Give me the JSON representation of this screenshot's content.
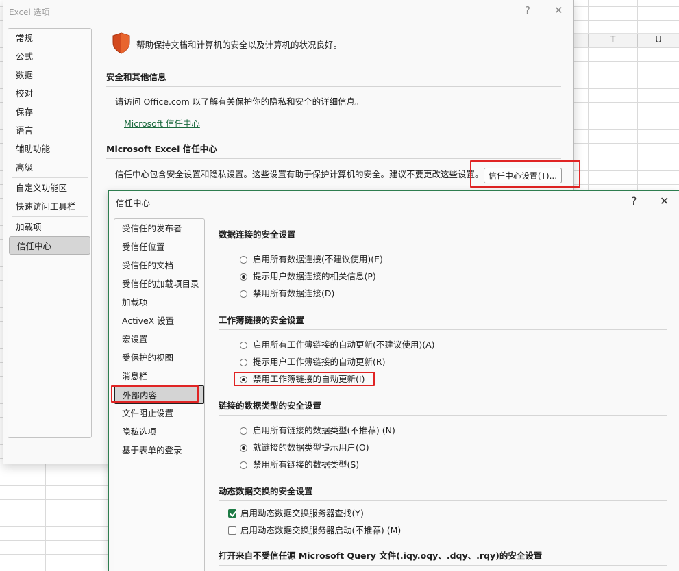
{
  "sheet": {
    "columns": [
      "T",
      "U"
    ]
  },
  "options_dialog": {
    "title": "Excel 选项",
    "help_glyph": "?",
    "close_glyph": "✕",
    "nav": [
      [
        "常规",
        "公式",
        "数据",
        "校对",
        "保存",
        "语言",
        "辅助功能",
        "高级"
      ],
      [
        "自定义功能区",
        "快速访问工具栏"
      ],
      [
        "加载项",
        "信任中心"
      ]
    ],
    "selected_nav": "信任中心",
    "intro": "帮助保持文档和计算机的安全以及计算机的状况良好。",
    "section1_title": "安全和其他信息",
    "section1_text": "请访问 Office.com 以了解有关保护你的隐私和安全的详细信息。",
    "section1_link": "Microsoft 信任中心",
    "section2_title": "Microsoft Excel 信任中心",
    "section2_text": "信任中心包含安全设置和隐私设置。这些设置有助于保护计算机的安全。建议不要更改这些设置。",
    "trust_button": "信任中心设置(T)..."
  },
  "trust_center": {
    "title": "信任中心",
    "help_glyph": "?",
    "close_glyph": "✕",
    "nav": [
      "受信任的发布者",
      "受信任位置",
      "受信任的文档",
      "受信任的加载项目录",
      "加载项",
      "ActiveX 设置",
      "宏设置",
      "受保护的视图",
      "消息栏",
      "外部内容",
      "文件阻止设置",
      "隐私选项",
      "基于表单的登录"
    ],
    "selected_nav": "外部内容",
    "groups": [
      {
        "title": "数据连接的安全设置",
        "options": [
          {
            "label": "启用所有数据连接(不建议使用)(E)",
            "checked": false
          },
          {
            "label": "提示用户数据连接的相关信息(P)",
            "checked": true
          },
          {
            "label": "禁用所有数据连接(D)",
            "checked": false
          }
        ]
      },
      {
        "title": "工作簿链接的安全设置",
        "options": [
          {
            "label": "启用所有工作簿链接的自动更新(不建议使用)(A)",
            "checked": false
          },
          {
            "label": "提示用户工作簿链接的自动更新(R)",
            "checked": false
          },
          {
            "label": "禁用工作簿链接的自动更新(I)",
            "checked": true
          }
        ]
      },
      {
        "title": "链接的数据类型的安全设置",
        "options": [
          {
            "label": "启用所有链接的数据类型(不推荐) (N)",
            "checked": false
          },
          {
            "label": "就链接的数据类型提示用户(O)",
            "checked": true
          },
          {
            "label": "禁用所有链接的数据类型(S)",
            "checked": false
          }
        ]
      },
      {
        "title": "动态数据交换的安全设置",
        "checkboxes": [
          {
            "label": "启用动态数据交换服务器查找(Y)",
            "checked": true
          },
          {
            "label": "启用动态数据交换服务器启动(不推荐) (M)",
            "checked": false
          }
        ]
      }
    ],
    "last_group_title": "打开来自不受信任源 Microsoft Query 文件(.iqy.oqy、.dqy、.rqy)的安全设置"
  },
  "colors": {
    "highlight": "#e02424",
    "accent": "#1e7b45",
    "link": "#1b6a3e"
  }
}
